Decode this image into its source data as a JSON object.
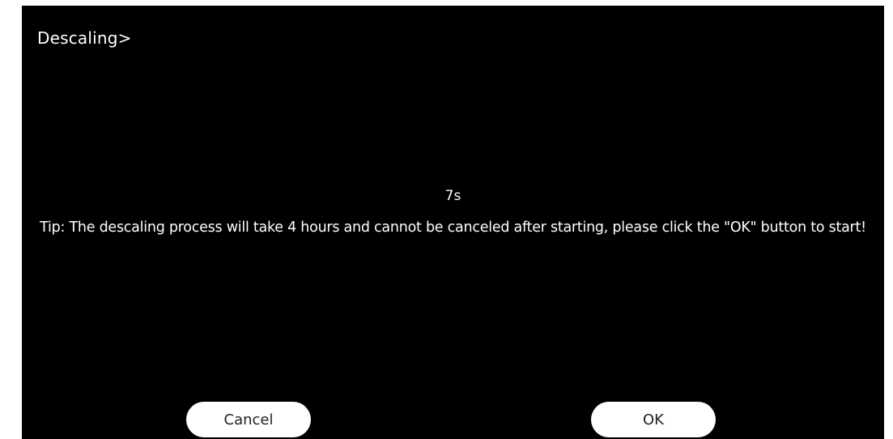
{
  "header": {
    "title": "Descaling>"
  },
  "main": {
    "countdown": "7s",
    "tip": "Tip: The descaling process will take 4 hours and cannot be canceled after starting, please click the \"OK\" button to start!"
  },
  "buttons": {
    "cancel_label": "Cancel",
    "ok_label": "OK"
  },
  "colors": {
    "background": "#000000",
    "text": "#ffffff",
    "button_bg": "#ffffff",
    "button_text": "#222222"
  }
}
